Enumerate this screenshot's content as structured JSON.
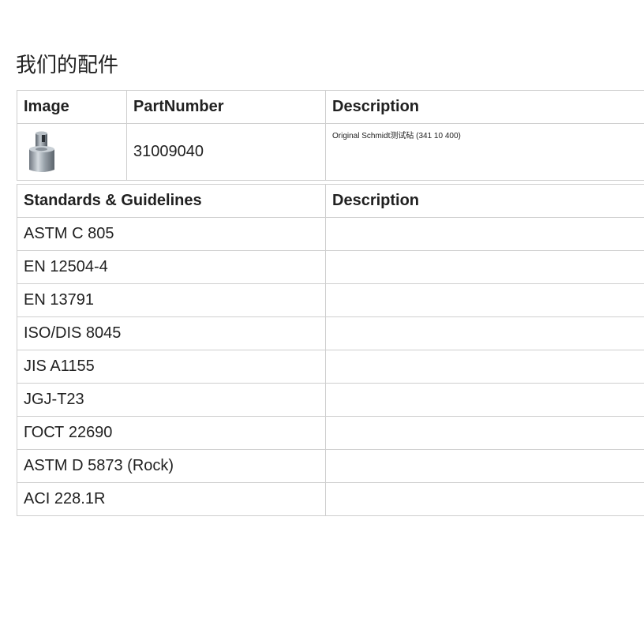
{
  "page": {
    "title": "我们的配件"
  },
  "parts_table": {
    "headers": {
      "image": "Image",
      "part_number": "PartNumber",
      "description": "Description"
    },
    "rows": [
      {
        "image_icon": "cylindrical-test-anvil",
        "part_number": "31009040",
        "description": "Original Schmidt测试砧 (341 10 400)"
      }
    ]
  },
  "standards_table": {
    "headers": {
      "standard": "Standards & Guidelines",
      "description": "Description"
    },
    "rows": [
      {
        "standard": "ASTM C 805",
        "description": ""
      },
      {
        "standard": "EN 12504-4",
        "description": ""
      },
      {
        "standard": "EN 13791",
        "description": ""
      },
      {
        "standard": "ISO/DIS 8045",
        "description": ""
      },
      {
        "standard": "JIS A1155",
        "description": ""
      },
      {
        "standard": "JGJ-T23",
        "description": ""
      },
      {
        "standard": "ГОСТ 22690",
        "description": ""
      },
      {
        "standard": "ASTM D 5873 (Rock)",
        "description": ""
      },
      {
        "standard": "ACI 228.1R",
        "description": ""
      }
    ]
  }
}
